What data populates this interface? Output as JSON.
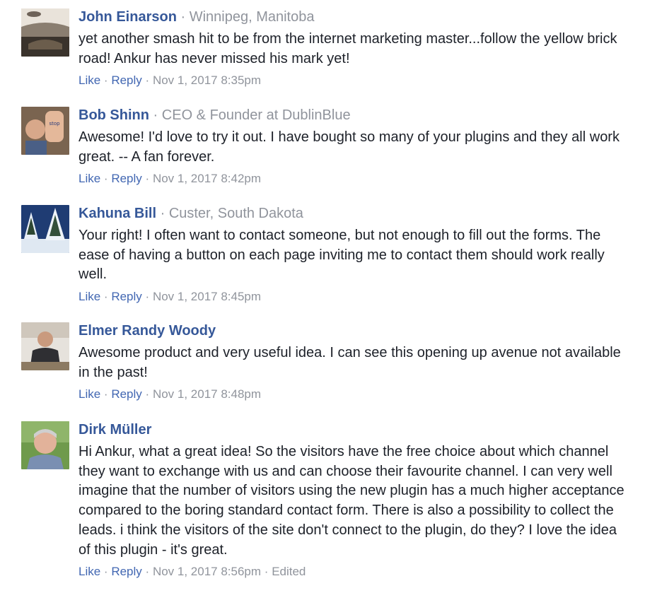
{
  "actions": {
    "like": "Like",
    "reply": "Reply",
    "dot": "·"
  },
  "comments": [
    {
      "author": "John Einarson",
      "meta": "Winnipeg, Manitoba",
      "text": "yet another smash hit to be from the internet marketing master...follow the yellow brick road! Ankur has never missed his mark yet!",
      "timestamp": "Nov 1, 2017 8:35pm",
      "avatar": "car-dashboard-photo"
    },
    {
      "author": "Bob Shinn",
      "meta": "CEO & Founder at DublinBlue",
      "text": "Awesome! I'd love to try it out. I have bought so many of your plugins and they all work great. -- A fan forever.",
      "timestamp": "Nov 1, 2017 8:42pm",
      "avatar": "man-raised-hand-photo"
    },
    {
      "author": "Kahuna Bill",
      "meta": "Custer, South Dakota",
      "text": "Your right! I often want to contact someone, but not enough to fill out the forms. The ease of having a button on each page inviting me to contact them should work really well.",
      "timestamp": "Nov 1, 2017 8:45pm",
      "avatar": "snowy-pine-trees-photo"
    },
    {
      "author": "Elmer Randy Woody",
      "meta": "",
      "text": "Awesome product and very useful idea. I can see this opening up avenue not available in the past!",
      "timestamp": "Nov 1, 2017 8:48pm",
      "avatar": "man-seated-photo"
    },
    {
      "author": "Dirk Müller",
      "meta": "",
      "text": "Hi Ankur, what a great idea! So the visitors have the free choice about which channel they want to exchange with us and can choose their favourite channel. I can very well imagine that the number of visitors using the new plugin has a much higher acceptance compared to the boring standard contact form. There is also a possibility to collect the leads. i think the visitors of the site don't connect to the plugin, do they? I love the idea of this plugin - it's great.",
      "timestamp": "Nov 1, 2017 8:56pm",
      "edited": "Edited",
      "avatar": "man-portrait-photo"
    }
  ],
  "colors": {
    "author_link": "#365899",
    "action_link": "#4267b2",
    "muted": "#90949c",
    "text": "#1d2129"
  }
}
